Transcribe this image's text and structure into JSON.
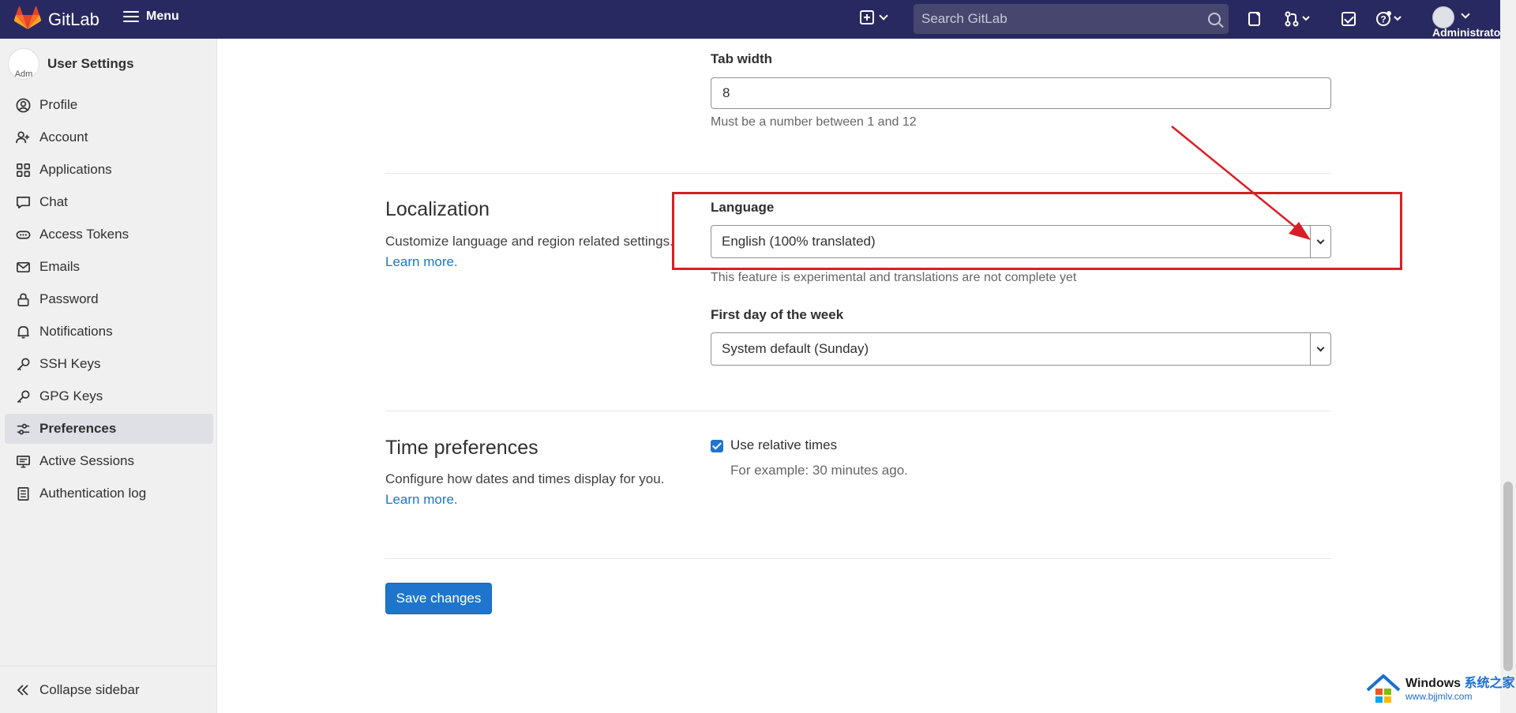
{
  "topbar": {
    "brand": "GitLab",
    "menu_label": "Menu",
    "search_placeholder": "Search GitLab",
    "user_label": "Administrator"
  },
  "sidebar": {
    "avatar_alt": "Adm",
    "title": "User Settings",
    "items": [
      {
        "label": "Profile",
        "icon": "profile-icon"
      },
      {
        "label": "Account",
        "icon": "account-icon"
      },
      {
        "label": "Applications",
        "icon": "applications-icon"
      },
      {
        "label": "Chat",
        "icon": "chat-icon"
      },
      {
        "label": "Access Tokens",
        "icon": "token-icon"
      },
      {
        "label": "Emails",
        "icon": "mail-icon"
      },
      {
        "label": "Password",
        "icon": "lock-icon"
      },
      {
        "label": "Notifications",
        "icon": "bell-icon"
      },
      {
        "label": "SSH Keys",
        "icon": "key-icon"
      },
      {
        "label": "GPG Keys",
        "icon": "key-icon"
      },
      {
        "label": "Preferences",
        "icon": "preferences-icon",
        "active": true
      },
      {
        "label": "Active Sessions",
        "icon": "monitor-icon"
      },
      {
        "label": "Authentication log",
        "icon": "log-icon"
      }
    ],
    "collapse_label": "Collapse sidebar"
  },
  "main": {
    "tab_width": {
      "label": "Tab width",
      "value": "8",
      "help": "Must be a number between 1 and 12"
    },
    "localization": {
      "title": "Localization",
      "description": "Customize language and region related settings.",
      "learn_more": "Learn more.",
      "language_label": "Language",
      "language_value": "English (100% translated)",
      "language_help": "This feature is experimental and translations are not complete yet",
      "first_day_label": "First day of the week",
      "first_day_value": "System default (Sunday)"
    },
    "time": {
      "title": "Time preferences",
      "description": "Configure how dates and times display for you.",
      "learn_more": "Learn more.",
      "relative_label": "Use relative times",
      "relative_checked": true,
      "relative_example": "For example: 30 minutes ago."
    },
    "save_label": "Save changes"
  },
  "watermark": {
    "line1_a": "Windows ",
    "line1_b": "系统之家",
    "line2": "www.bjjmlv.com"
  },
  "colors": {
    "navbar": "#292961",
    "accent": "#1f75cb",
    "annotation": "#d81f26"
  }
}
